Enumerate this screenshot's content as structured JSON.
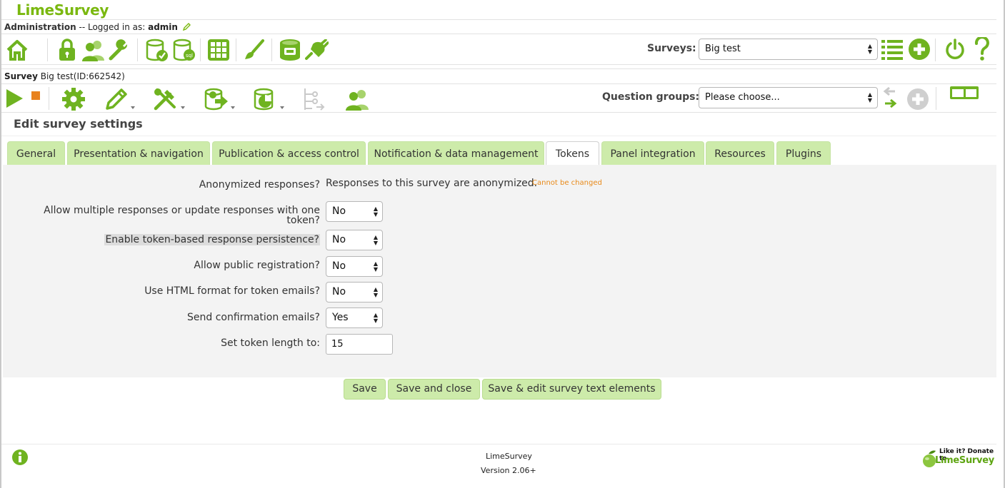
{
  "app": {
    "logo": "LimeSurvey"
  },
  "admin_bar": {
    "label": "Administration",
    "logged_in_prefix": "-- Logged in as:",
    "username": "admin"
  },
  "admin_toolbar": {
    "icons": [
      "home-icon",
      "lock-icon",
      "users-icon",
      "wrench-icon",
      "database-check-icon",
      "database-sql-icon",
      "grid-icon",
      "brush-icon",
      "database-label-icon",
      "plugin-icon"
    ],
    "surveys_label": "Surveys:",
    "surveys_selected": "Big test",
    "right_icons": [
      "survey-list-icon",
      "add-survey-icon",
      "logout-icon",
      "help-icon"
    ]
  },
  "survey_bar": {
    "label": "Survey",
    "title": "Big test(ID:662542)"
  },
  "survey_toolbar": {
    "icons": [
      "play-icon",
      "stop-icon",
      "settings-icon",
      "edit-icon",
      "tools-icon",
      "display-export-icon",
      "responses-icon",
      "structure-icon",
      "participants-icon"
    ],
    "groups_label": "Question groups:",
    "groups_selected": "Please choose...",
    "right_icons": [
      "reorder-icon",
      "add-group-icon",
      "layout-toggle-icon"
    ]
  },
  "page_heading": "Edit survey settings",
  "tabs": [
    {
      "label": "General",
      "active": false
    },
    {
      "label": "Presentation & navigation",
      "active": false
    },
    {
      "label": "Publication & access control",
      "active": false
    },
    {
      "label": "Notification & data management",
      "active": false
    },
    {
      "label": "Tokens",
      "active": true
    },
    {
      "label": "Panel integration",
      "active": false
    },
    {
      "label": "Resources",
      "active": false
    },
    {
      "label": "Plugins",
      "active": false
    }
  ],
  "form": {
    "anonymized": {
      "label": "Anonymized responses?",
      "value": "Responses to this survey are anonymized.",
      "note": "Cannot be changed"
    },
    "allow_multiple": {
      "label_line1": "Allow multiple responses or update responses with one",
      "label_line2": "token?",
      "value": "No"
    },
    "token_persistence": {
      "label": "Enable token-based response persistence?",
      "value": "No"
    },
    "public_registration": {
      "label": "Allow public registration?",
      "value": "No"
    },
    "html_email": {
      "label": "Use HTML format for token emails?",
      "value": "No"
    },
    "confirmation_emails": {
      "label": "Send confirmation emails?",
      "value": "Yes"
    },
    "token_length": {
      "label": "Set token length to:",
      "value": "15"
    }
  },
  "buttons": {
    "save": "Save",
    "save_close": "Save and close",
    "save_edit_text": "Save & edit survey text elements"
  },
  "footer": {
    "name": "LimeSurvey",
    "version": "Version 2.06+",
    "donate_line1": "Like it? Donate to",
    "donate_line2": "LimeSurvey"
  },
  "colors": {
    "brand_green": "#7ab80f",
    "tab_green": "#cdebaa",
    "icon_green": "#6fb320",
    "stop_orange": "#e8821e",
    "note_orange": "#e88a1a"
  }
}
